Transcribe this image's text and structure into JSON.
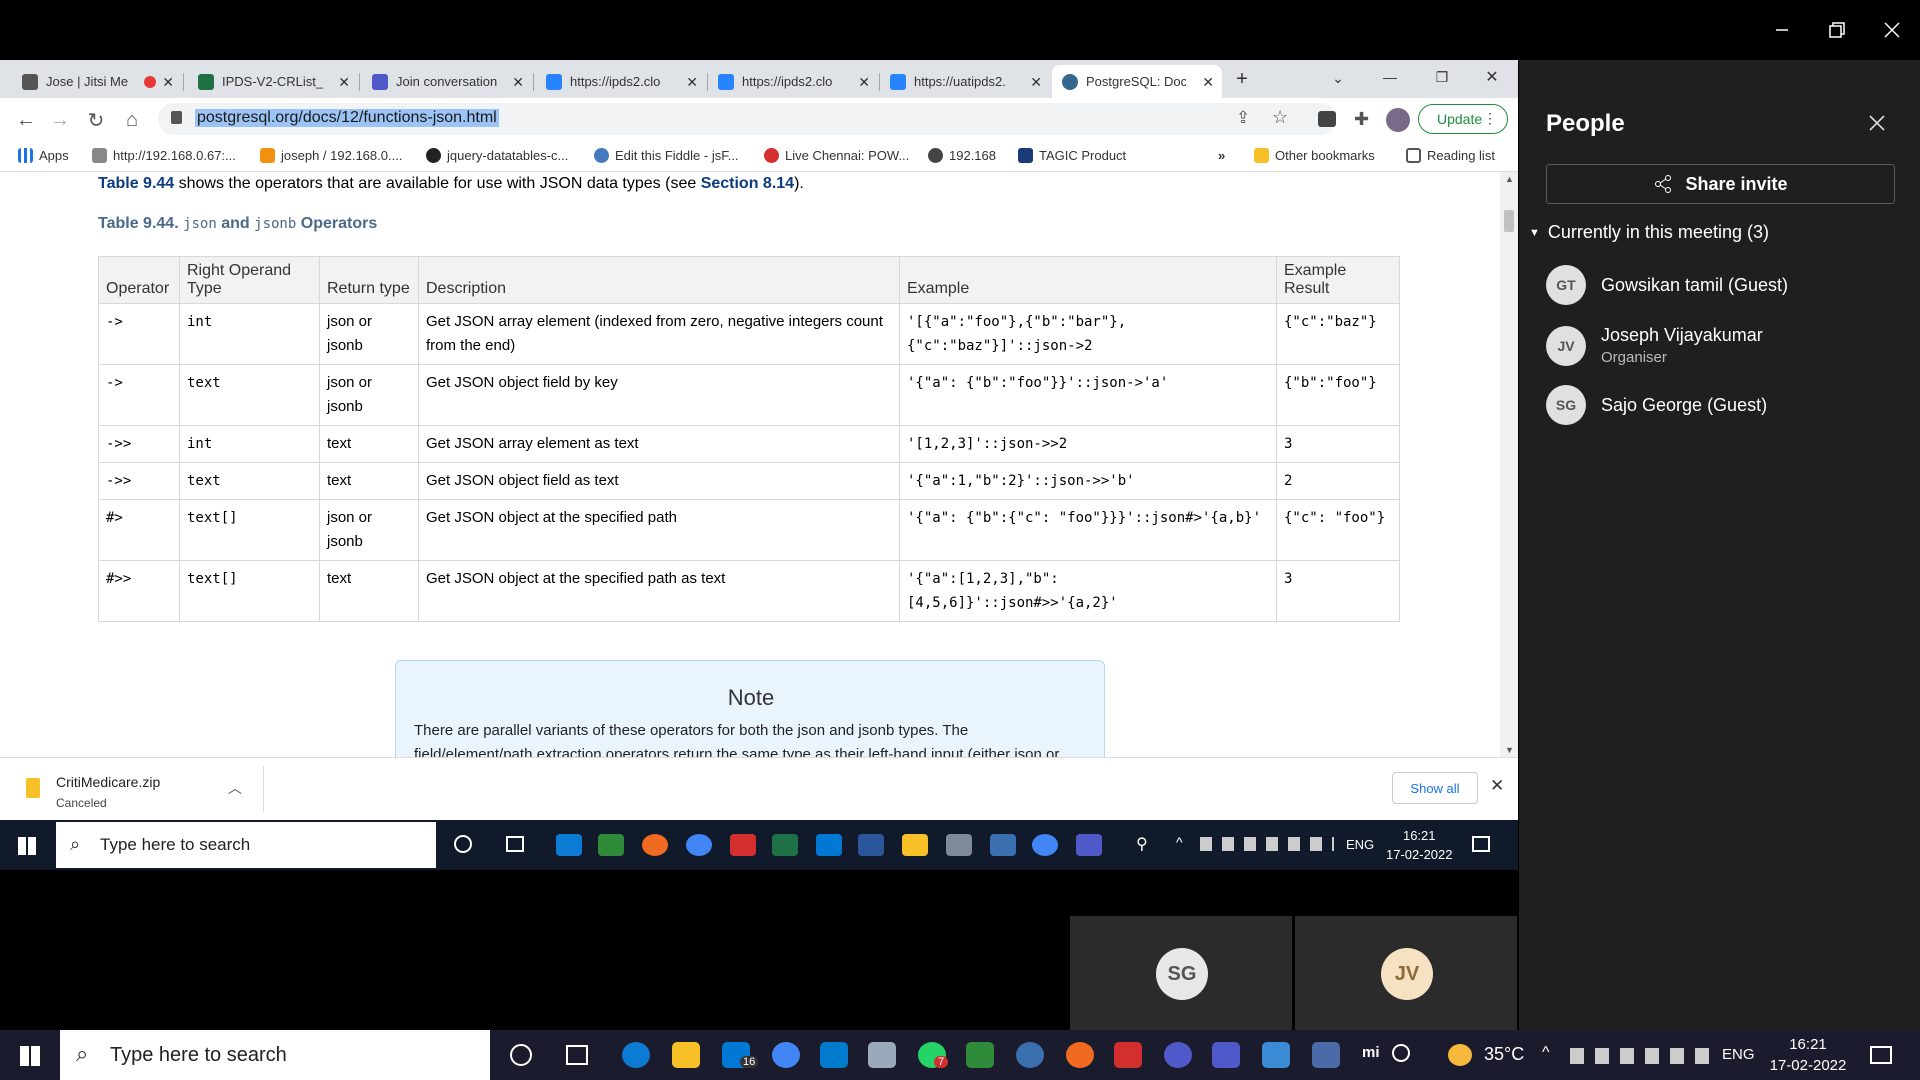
{
  "people_panel": {
    "title": "People",
    "share_label": "Share invite",
    "in_meeting_label": "Currently in this meeting (3)",
    "participants": [
      {
        "initials": "GT",
        "name": "Gowsikan tamil (Guest)",
        "role": ""
      },
      {
        "initials": "JV",
        "name": "Joseph Vijayakumar",
        "role": "Organiser"
      },
      {
        "initials": "SG",
        "name": "Sajo George (Guest)",
        "role": ""
      }
    ]
  },
  "browser": {
    "tabs": [
      {
        "label": "Jose | Jitsi Me",
        "icon": "jitsi-icon",
        "color": "#c0392b"
      },
      {
        "label": "IPDS-V2-CRList_",
        "icon": "excel-icon",
        "color": "#1e7145"
      },
      {
        "label": "Join conversation",
        "icon": "teams-icon",
        "color": "#5059c9"
      },
      {
        "label": "https://ipds2.clo",
        "icon": "jira-icon",
        "color": "#2684ff"
      },
      {
        "label": "https://ipds2.clo",
        "icon": "jira-icon",
        "color": "#2684ff"
      },
      {
        "label": "https://uatipds2.",
        "icon": "jira-icon",
        "color": "#2684ff"
      },
      {
        "label": "PostgreSQL: Doc",
        "icon": "postgres-icon",
        "color": "#336791"
      }
    ],
    "url": "postgresql.org/docs/12/functions-json.html",
    "update_label": "Update",
    "bookmarks": [
      {
        "label": "Apps",
        "icon": "apps-grid-icon"
      },
      {
        "label": "http://192.168.0.67:...",
        "icon": "page-icon"
      },
      {
        "label": "joseph / 192.168.0....",
        "icon": "phpmyadmin-icon"
      },
      {
        "label": "jquery-datatables-c...",
        "icon": "github-icon"
      },
      {
        "label": "Edit this Fiddle - jsF...",
        "icon": "jsfiddle-icon"
      },
      {
        "label": "Live Chennai: POW...",
        "icon": "livechennai-icon"
      },
      {
        "label": "192.168",
        "icon": "globe-icon"
      },
      {
        "label": "TAGIC Product",
        "icon": "tagic-icon"
      },
      {
        "label": "Other bookmarks",
        "icon": "folder-icon"
      },
      {
        "label": "Reading list",
        "icon": "reading-list-icon"
      }
    ]
  },
  "page": {
    "intro": {
      "lead": "Table 9.44",
      "mid": " shows the operators that are available for use with JSON data types (see ",
      "link": "Section 8.14",
      "tail": ")."
    },
    "caption": {
      "lead": "Table 9.44. ",
      "c1": "json",
      "and": " and ",
      "c2": "jsonb",
      "tail": " Operators"
    },
    "headers": [
      "Operator",
      "Right Operand Type",
      "Return type",
      "Description",
      "Example",
      "Example Result"
    ],
    "rows": [
      {
        "op": "->",
        "rtype": "int",
        "ret": "json or jsonb",
        "desc": "Get JSON array element (indexed from zero, negative integers count from the end)",
        "ex": "'[{\"a\":\"foo\"},{\"b\":\"bar\"},{\"c\":\"baz\"}]'::json->2",
        "res": "{\"c\":\"baz\"}"
      },
      {
        "op": "->",
        "rtype": "text",
        "ret": "json or jsonb",
        "desc": "Get JSON object field by key",
        "ex": "'{\"a\": {\"b\":\"foo\"}}'::json->'a'",
        "res": "{\"b\":\"foo\"}"
      },
      {
        "op": "->>",
        "rtype": "int",
        "ret": "text",
        "desc": "Get JSON array element as text",
        "ex": "'[1,2,3]'::json->>2",
        "res": "3"
      },
      {
        "op": "->>",
        "rtype": "text",
        "ret": "text",
        "desc": "Get JSON object field as text",
        "ex": "'{\"a\":1,\"b\":2}'::json->>'b'",
        "res": "2"
      },
      {
        "op": "#>",
        "rtype": "text[]",
        "ret": "json or jsonb",
        "desc": "Get JSON object at the specified path",
        "ex": "'{\"a\": {\"b\":{\"c\": \"foo\"}}}'::json#>'{a,b}'",
        "res": "{\"c\": \"foo\"}"
      },
      {
        "op": "#>>",
        "rtype": "text[]",
        "ret": "text",
        "desc": "Get JSON object at the specified path as text",
        "ex": "'{\"a\":[1,2,3],\"b\":[4,5,6]}'::json#>>'{a,2}'",
        "res": "3"
      }
    ],
    "note": {
      "title": "Note",
      "body": "There are parallel variants of these operators for both the json and jsonb types. The field/element/path extraction operators return the same type as their left-hand input (either json or jsonb), except for those specified as returning text, which coerce the value to text. The field/element/path extraction operators return NULL, rather than failing"
    }
  },
  "downloads": {
    "filename": "CritiMedicare.zip",
    "status": "Canceled",
    "show_all": "Show all"
  },
  "inner_taskbar": {
    "search_placeholder": "Type here to search",
    "lang": "ENG",
    "time": "16:21",
    "date": "17-02-2022"
  },
  "thumbnails": [
    {
      "initials": "SG"
    },
    {
      "initials": "JV"
    }
  ],
  "taskbar": {
    "search_placeholder": "Type here to search",
    "weather": "35°C",
    "lang": "ENG",
    "time": "16:21",
    "date": "17-02-2022",
    "mail_badge": "16",
    "whatsapp_badge": "7"
  }
}
